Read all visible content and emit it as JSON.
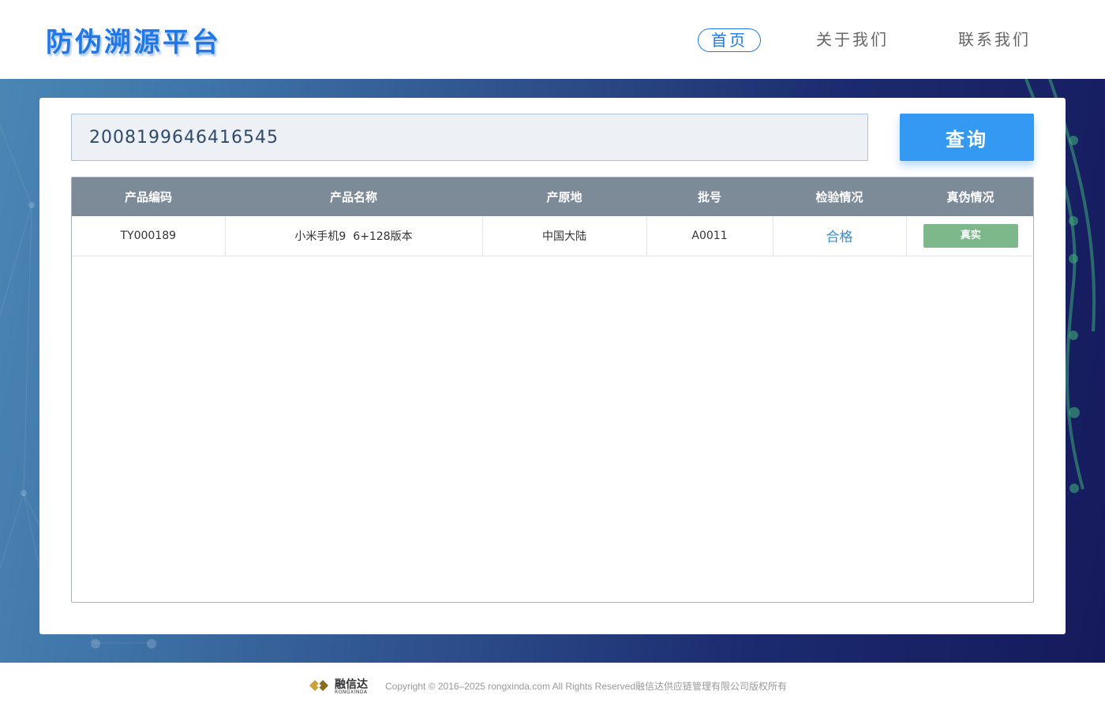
{
  "brand": {
    "title": "防伪溯源平台"
  },
  "nav": [
    {
      "label": "首页",
      "active": true
    },
    {
      "label": "关于我们",
      "active": false
    },
    {
      "label": "联系我们",
      "active": false
    }
  ],
  "search": {
    "value": "2008199646416545",
    "button_label": "查询"
  },
  "table": {
    "headers": [
      "产品编码",
      "产品名称",
      "产原地",
      "批号",
      "检验情况",
      "真伪情况"
    ],
    "rows": [
      {
        "code": "TY000189",
        "name": "小米手机9  6+128版本",
        "origin": "中国大陆",
        "batch": "A0011",
        "inspection": "合格",
        "authenticity": "真实"
      }
    ]
  },
  "footer": {
    "logo_text": "融信达",
    "logo_sub": "RONGXINDA",
    "copyright": "Copyright © 2016–2025 rongxinda.com All Rights Reserved融信达供应链管理有限公司版权所有"
  },
  "colors": {
    "brand_blue": "#1f77e8",
    "button_blue": "#3399f3",
    "table_header": "#7d8a98",
    "authentic_badge": "#7db88a"
  }
}
